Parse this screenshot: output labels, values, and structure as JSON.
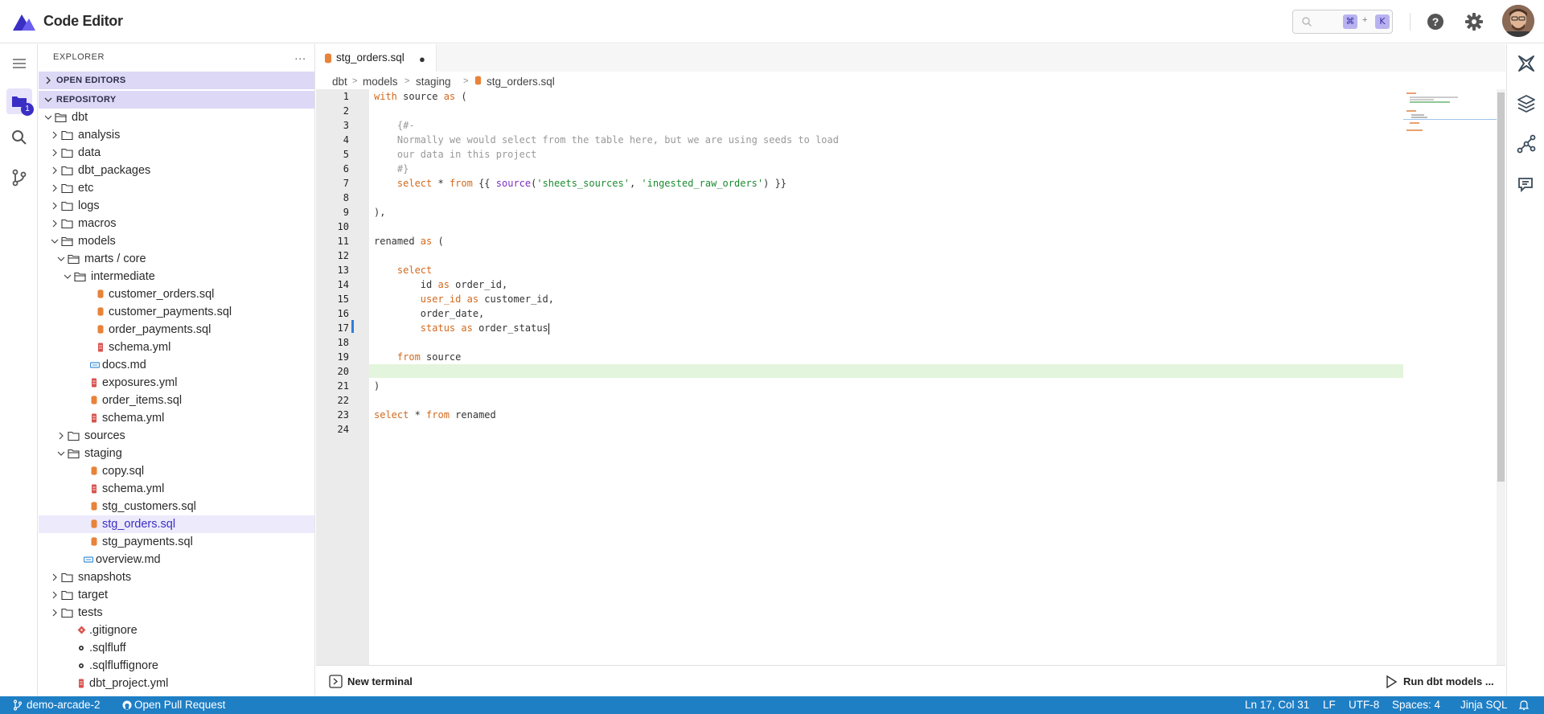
{
  "header": {
    "title": "Code Editor",
    "shortcut_keys": [
      "⌘",
      "K"
    ],
    "shortcut_plus": "+"
  },
  "activity": {
    "files_badge": "1"
  },
  "explorer": {
    "title": "EXPLORER",
    "more": "...",
    "open_editors_label": "OPEN EDITORS",
    "repository_label": "REPOSITORY",
    "tree": [
      {
        "name": "dbt",
        "type": "folder",
        "depth": 0,
        "open": true
      },
      {
        "name": "analysis",
        "type": "folder",
        "depth": 1,
        "open": false
      },
      {
        "name": "data",
        "type": "folder",
        "depth": 1,
        "open": false
      },
      {
        "name": "dbt_packages",
        "type": "folder",
        "depth": 1,
        "open": false
      },
      {
        "name": "etc",
        "type": "folder",
        "depth": 1,
        "open": false
      },
      {
        "name": "logs",
        "type": "folder",
        "depth": 1,
        "open": false
      },
      {
        "name": "macros",
        "type": "folder",
        "depth": 1,
        "open": false
      },
      {
        "name": "models",
        "type": "folder",
        "depth": 1,
        "open": true
      },
      {
        "name": "marts / core",
        "type": "folder",
        "depth": 2,
        "open": true
      },
      {
        "name": "intermediate",
        "type": "folder",
        "depth": 3,
        "open": true
      },
      {
        "name": "customer_orders.sql",
        "type": "sql",
        "depth": 4
      },
      {
        "name": "customer_payments.sql",
        "type": "sql",
        "depth": 4
      },
      {
        "name": "order_payments.sql",
        "type": "sql",
        "depth": 4
      },
      {
        "name": "schema.yml",
        "type": "yml",
        "depth": 4
      },
      {
        "name": "docs.md",
        "type": "md",
        "depth": 3
      },
      {
        "name": "exposures.yml",
        "type": "yml",
        "depth": 3
      },
      {
        "name": "order_items.sql",
        "type": "sql",
        "depth": 3
      },
      {
        "name": "schema.yml",
        "type": "yml",
        "depth": 3
      },
      {
        "name": "sources",
        "type": "folder",
        "depth": 2,
        "open": false
      },
      {
        "name": "staging",
        "type": "folder",
        "depth": 2,
        "open": true
      },
      {
        "name": "copy.sql",
        "type": "sql",
        "depth": 3
      },
      {
        "name": "schema.yml",
        "type": "yml",
        "depth": 3
      },
      {
        "name": "stg_customers.sql",
        "type": "sql",
        "depth": 3
      },
      {
        "name": "stg_orders.sql",
        "type": "sql",
        "depth": 3,
        "active": true
      },
      {
        "name": "stg_payments.sql",
        "type": "sql",
        "depth": 3
      },
      {
        "name": "overview.md",
        "type": "md",
        "depth": 2
      },
      {
        "name": "snapshots",
        "type": "folder",
        "depth": 1,
        "open": false
      },
      {
        "name": "target",
        "type": "folder",
        "depth": 1,
        "open": false
      },
      {
        "name": "tests",
        "type": "folder",
        "depth": 1,
        "open": false
      },
      {
        "name": ".gitignore",
        "type": "git",
        "depth": 1
      },
      {
        "name": ".sqlfluff",
        "type": "cfg",
        "depth": 1
      },
      {
        "name": ".sqlfluffignore",
        "type": "cfg",
        "depth": 1
      },
      {
        "name": "dbt_project.yml",
        "type": "yml",
        "depth": 1
      }
    ]
  },
  "editor": {
    "tab_name": "stg_orders.sql",
    "tab_dirty": "●",
    "breadcrumbs": [
      "dbt",
      "models",
      "staging",
      "stg_orders.sql"
    ],
    "current_line": 17,
    "lines": [
      [
        {
          "t": "with",
          "c": "kw"
        },
        {
          "t": " source "
        },
        {
          "t": "as",
          "c": "kw"
        },
        {
          "t": " ("
        }
      ],
      [],
      [
        {
          "t": "    {#-",
          "c": "cmt"
        }
      ],
      [
        {
          "t": "    Normally we would select from the table here, but we are using seeds to load",
          "c": "cmt"
        }
      ],
      [
        {
          "t": "    our data in this project",
          "c": "cmt"
        }
      ],
      [
        {
          "t": "    #}",
          "c": "cmt"
        }
      ],
      [
        {
          "t": "    "
        },
        {
          "t": "select",
          "c": "kw"
        },
        {
          "t": " * "
        },
        {
          "t": "from",
          "c": "kw"
        },
        {
          "t": " {{ "
        },
        {
          "t": "source",
          "c": "fn"
        },
        {
          "t": "("
        },
        {
          "t": "'sheets_sources'",
          "c": "str"
        },
        {
          "t": ", "
        },
        {
          "t": "'ingested_raw_orders'",
          "c": "str"
        },
        {
          "t": ") }}"
        }
      ],
      [],
      [
        {
          "t": "),"
        }
      ],
      [],
      [
        {
          "t": "renamed "
        },
        {
          "t": "as",
          "c": "kw"
        },
        {
          "t": " ("
        }
      ],
      [],
      [
        {
          "t": "    "
        },
        {
          "t": "select",
          "c": "kw"
        }
      ],
      [
        {
          "t": "        id "
        },
        {
          "t": "as",
          "c": "kw"
        },
        {
          "t": " order_id,"
        }
      ],
      [
        {
          "t": "        "
        },
        {
          "t": "user_id",
          "c": "kw"
        },
        {
          "t": " "
        },
        {
          "t": "as",
          "c": "kw"
        },
        {
          "t": " customer_id,"
        }
      ],
      [
        {
          "t": "        order_date,"
        }
      ],
      [
        {
          "t": "        "
        },
        {
          "t": "status",
          "c": "kw"
        },
        {
          "t": " "
        },
        {
          "t": "as",
          "c": "kw"
        },
        {
          "t": " order_status"
        }
      ],
      [],
      [
        {
          "t": "    "
        },
        {
          "t": "from",
          "c": "kw"
        },
        {
          "t": " source"
        }
      ],
      [],
      [
        {
          "t": ")"
        }
      ],
      [],
      [
        {
          "t": "select",
          "c": "kw"
        },
        {
          "t": " * "
        },
        {
          "t": "from",
          "c": "kw"
        },
        {
          "t": " renamed"
        }
      ],
      []
    ]
  },
  "bottom": {
    "new_terminal": "New terminal",
    "run_models": "Run dbt models ..."
  },
  "status": {
    "branch": "demo-arcade-2",
    "pull_request": "Open Pull Request",
    "position": "Ln 17, Col 31",
    "eol": "LF",
    "encoding": "UTF-8",
    "spaces": "Spaces: 4",
    "language": "Jinja SQL"
  },
  "colors": {
    "accent": "#3a2fc4",
    "status_bar": "#1f7fc5",
    "keyword": "#d2691e",
    "string": "#1b8b2f",
    "comment": "#999999",
    "current_line": "#e3f5dd"
  }
}
